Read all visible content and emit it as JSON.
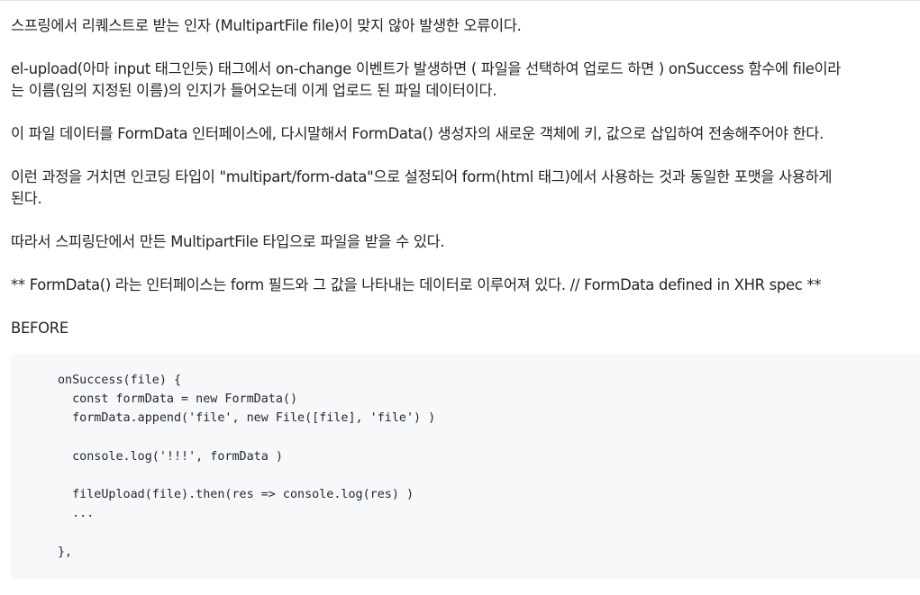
{
  "article": {
    "paragraphs": [
      {
        "lines": [
          "스프링에서 리퀘스트로 받는 인자 (MultipartFile file)이 맞지 않아 발생한 오류이다."
        ]
      },
      {
        "lines": [
          "el-upload(아마 input 태그인듯) 태그에서 on-change 이벤트가 발생하면 ( 파일을 선택하여 업로드 하면 ) onSuccess 함수에 file이라",
          "는 이름(임의 지정된 이름)의 인지가 들어오는데 이게 업로드 된 파일 데이터이다."
        ]
      },
      {
        "lines": [
          "이 파일 데이터를 FormData 인터페이스에, 다시말해서 FormData() 생성자의 새로운 객체에 키, 값으로 삽입하여 전송해주어야 한다."
        ]
      },
      {
        "lines": [
          "이런 과정을 거치면 인코딩 타입이 \"multipart/form-data\"으로 설정되어 form(html 태그)에서 사용하는 것과 동일한 포맷을 사용하게",
          "된다."
        ]
      },
      {
        "lines": [
          "따라서 스피링단에서 만든 MultipartFile 타입으로 파일을 받을 수 있다."
        ]
      },
      {
        "lines": [
          "** FormData() 라는 인터페이스는 form 필드와 그 값을 나타내는 데이터로 이루어져 있다. // FormData defined in XHR spec **"
        ]
      }
    ],
    "before_label": "BEFORE",
    "code_lines": [
      "onSuccess(file) {",
      "  const formData = new FormData()",
      "  formData.append('file', new File([file], 'file') )",
      "",
      "  console.log('!!!', formData )",
      "",
      "  fileUpload(file).then(res => console.log(res) )",
      "  ...",
      "",
      "},"
    ]
  }
}
